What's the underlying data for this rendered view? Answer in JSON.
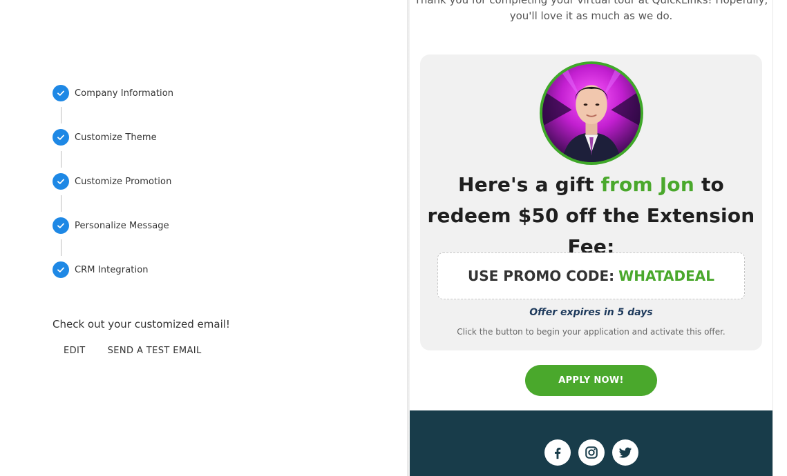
{
  "steps": [
    {
      "label": "Company Information",
      "status": "complete"
    },
    {
      "label": "Customize Theme",
      "status": "complete"
    },
    {
      "label": "Customize Promotion",
      "status": "complete"
    },
    {
      "label": "Personalize Message",
      "status": "complete"
    },
    {
      "label": "CRM Integration",
      "status": "complete"
    }
  ],
  "review": {
    "prompt": "Check out your customized email!",
    "edit_label": "EDIT",
    "test_label": "SEND A TEST EMAIL"
  },
  "email": {
    "intro_line1": "Thank you for completing your virtual tour at QuickLinks! Hopefully,",
    "intro_line2": "you'll love it as much as we do.",
    "headline_pre": "Here's a gift",
    "headline_accent": "from Jon",
    "headline_post": "to redeem $50 off the Extension Fee:",
    "promo_label": "USE PROMO CODE:",
    "promo_code": "WHATADEAL",
    "expires": "Offer expires in 5 days",
    "instructions": "Click the button to begin your application and activate this offer.",
    "apply_label": "APPLY NOW!",
    "socials": [
      "facebook-icon",
      "instagram-icon",
      "twitter-icon"
    ]
  },
  "colors": {
    "step_check": "#1e88e5",
    "accent_green": "#4aa82c",
    "footer_bg": "#183c4a",
    "expires_text": "#1e3a5c"
  }
}
